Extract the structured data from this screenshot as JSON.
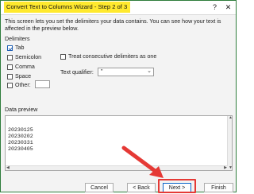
{
  "dialog": {
    "title": "Convert Text to Columns Wizard - Step 2 of 3",
    "help_label": "?",
    "close_label": "✕",
    "description": "This screen lets you set the delimiters your data contains.  You can see how your text is affected in the preview below."
  },
  "delimiters": {
    "group_label": "Delimiters",
    "items": [
      {
        "label": "Tab",
        "checked": true
      },
      {
        "label": "Semicolon",
        "checked": false
      },
      {
        "label": "Comma",
        "checked": false
      },
      {
        "label": "Space",
        "checked": false
      },
      {
        "label": "Other:",
        "checked": false
      }
    ],
    "other_value": ""
  },
  "options": {
    "consecutive_label": "Treat consecutive delimiters as one",
    "consecutive_checked": false,
    "qualifier_label": "Text qualifier:",
    "qualifier_value": "\""
  },
  "preview": {
    "group_label": "Data preview",
    "lines": [
      "20230125",
      "20230202",
      "20230331",
      "20230405"
    ]
  },
  "buttons": {
    "cancel": "Cancel",
    "back": "< Back",
    "next": "Next >",
    "finish": "Finish"
  },
  "colors": {
    "title_highlight": "#ffe92e",
    "callout": "#e53935",
    "accent": "#1f5fb3"
  },
  "icons": [
    "help-icon",
    "close-icon",
    "checkmark-icon",
    "chevron-down-icon",
    "red-arrow-icon"
  ]
}
